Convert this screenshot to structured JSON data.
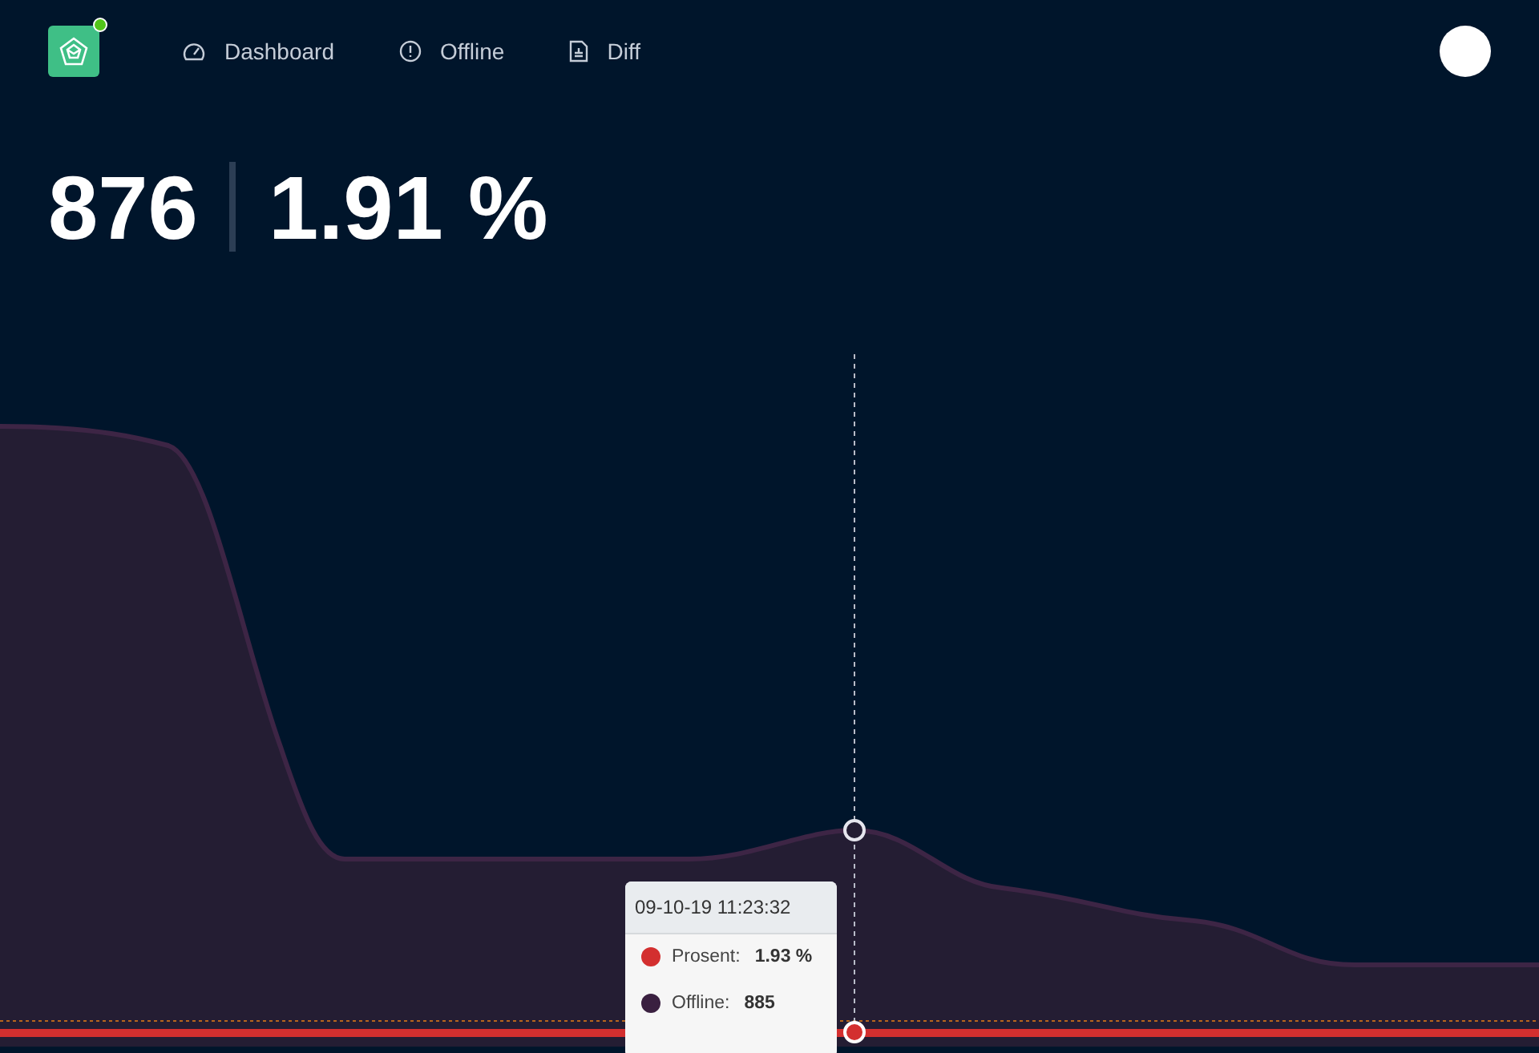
{
  "header": {
    "status_online": true,
    "nav": [
      {
        "kind": "gauge",
        "label": "Dashboard"
      },
      {
        "kind": "alert",
        "label": "Offline"
      },
      {
        "kind": "document",
        "label": "Diff"
      }
    ]
  },
  "stats": {
    "count": "876",
    "percent": "1.91 %"
  },
  "tooltip": {
    "time": "09-10-19 11:23:32",
    "rows": [
      {
        "label": "Prosent:",
        "value": "1.93 %",
        "color": "#d32f2f"
      },
      {
        "label": "Offline:",
        "value": "885",
        "color": "#3a2040"
      }
    ]
  }
}
